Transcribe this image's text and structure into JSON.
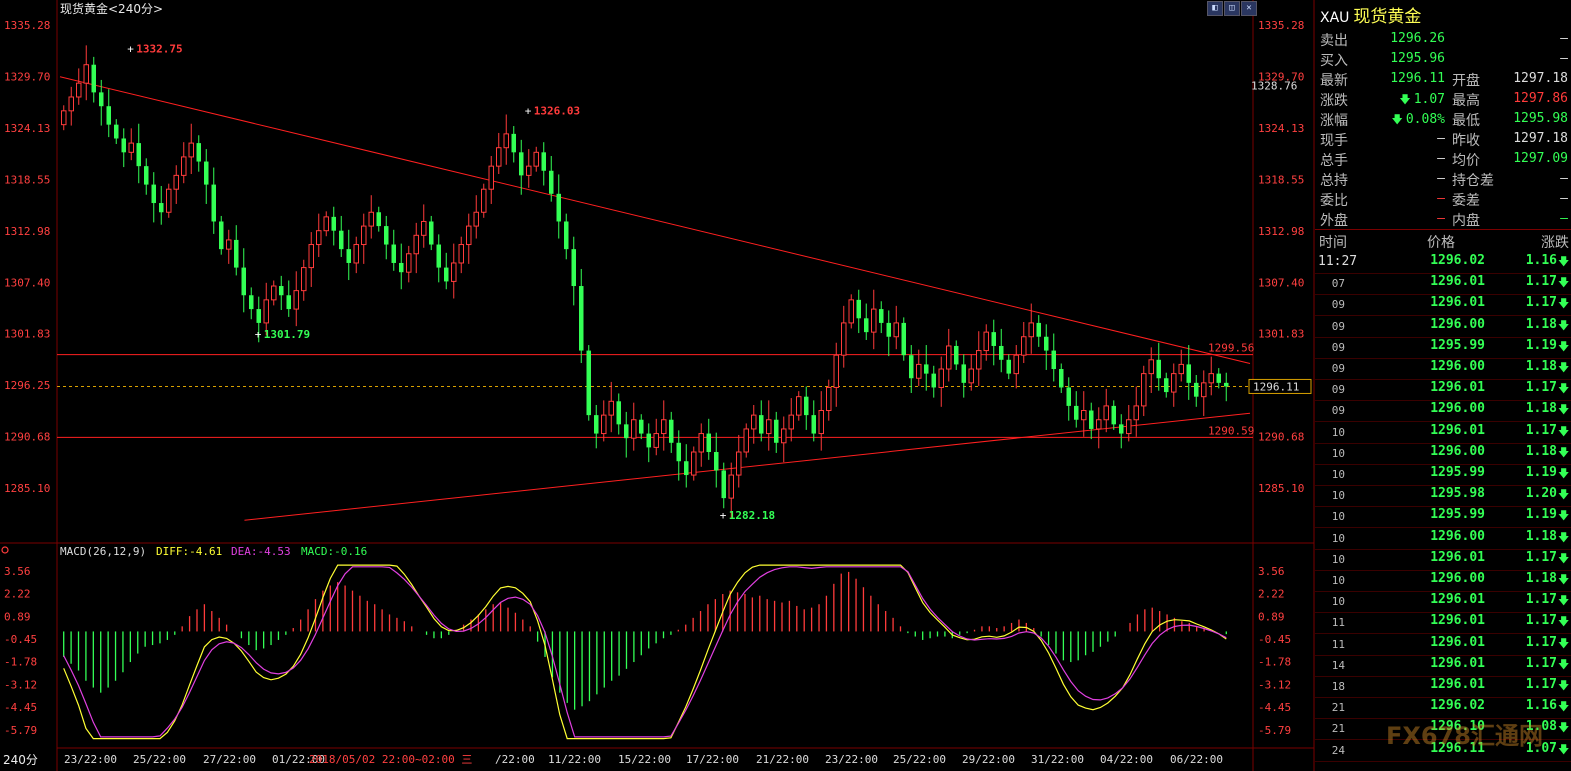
{
  "header": {
    "title": "现货黄金<240分>",
    "macd_label": "MACD(26,12,9)",
    "diff_label": "DIFF:-4.61",
    "dea_label": "DEA:-4.53",
    "macd_value_label": "MACD:-0.16",
    "period_label": "240分",
    "date_overlay": "2018/05/02 22:00~02:00 三"
  },
  "colors": {
    "up": "#ff3b3b",
    "down": "#33ff55",
    "diff": "#ffff33",
    "dea": "#e040e0",
    "trend": "#ff2020"
  },
  "chart_data": {
    "type": "candlestick",
    "price_axis_ticks": [
      "1335.28",
      "1329.70",
      "1324.13",
      "1318.55",
      "1312.98",
      "1307.40",
      "1301.83",
      "1296.25",
      "1290.68",
      "1285.10"
    ],
    "right_axis_extra": "1328.76",
    "ylim": [
      1280.0,
      1336.5
    ],
    "x_ticks": [
      "23/22:00",
      "25/22:00",
      "27/22:00",
      "01/22:00",
      "/22:00",
      "11/22:00",
      "15/22:00",
      "17/22:00",
      "21/22:00",
      "23/22:00",
      "25/22:00",
      "29/22:00",
      "31/22:00",
      "04/22:00",
      "06/22:00"
    ],
    "annotations": {
      "high1": "1332.75",
      "high2": "1326.03",
      "low1": "1301.79",
      "low2": "1282.18",
      "resistance": "1299.56",
      "support": "1290.59",
      "current": "1296.11"
    },
    "levels": {
      "resistance": 1299.56,
      "support": 1290.59,
      "current": 1296.11
    },
    "trendlines": [
      {
        "from": [
          0,
          1329.7
        ],
        "to": [
          1.0,
          1298.6
        ]
      },
      {
        "from": [
          0.155,
          1281.6
        ],
        "to": [
          1.0,
          1293.2
        ]
      }
    ],
    "macd_axis_ticks": [
      "3.56",
      "2.22",
      "0.89",
      "-0.45",
      "-1.78",
      "-3.12",
      "-4.45",
      "-5.79"
    ],
    "macd_ylim": [
      -6.5,
      4.2
    ],
    "diff_last": -4.61,
    "dea_last": -4.53,
    "macd_last": -0.16,
    "closes": [
      1326.0,
      1327.5,
      1329.0,
      1331.0,
      1328.0,
      1326.5,
      1324.5,
      1323.0,
      1321.5,
      1322.5,
      1320.0,
      1318.0,
      1316.0,
      1315.0,
      1317.5,
      1319.0,
      1321.0,
      1322.5,
      1320.5,
      1318.0,
      1314.0,
      1311.0,
      1312.0,
      1309.0,
      1306.0,
      1304.5,
      1303.0,
      1305.5,
      1307.0,
      1306.0,
      1304.5,
      1306.5,
      1309.0,
      1311.5,
      1313.0,
      1314.5,
      1313.0,
      1311.0,
      1309.5,
      1311.5,
      1313.5,
      1315.0,
      1313.5,
      1311.5,
      1309.5,
      1308.5,
      1310.5,
      1312.5,
      1314.0,
      1311.5,
      1309.0,
      1307.5,
      1309.5,
      1311.5,
      1313.5,
      1315.0,
      1317.5,
      1320.0,
      1322.0,
      1323.5,
      1321.5,
      1319.0,
      1320.0,
      1321.5,
      1319.5,
      1317.0,
      1314.0,
      1311.0,
      1307.0,
      1300.0,
      1293.0,
      1291.0,
      1293.0,
      1294.5,
      1292.0,
      1290.5,
      1292.5,
      1291.0,
      1289.5,
      1291.0,
      1292.5,
      1290.0,
      1288.0,
      1286.5,
      1289.0,
      1291.0,
      1289.0,
      1287.0,
      1284.0,
      1286.5,
      1289.0,
      1291.5,
      1293.0,
      1291.0,
      1292.5,
      1290.0,
      1291.5,
      1293.0,
      1295.0,
      1293.0,
      1291.0,
      1293.5,
      1296.0,
      1299.5,
      1303.0,
      1305.5,
      1303.5,
      1302.0,
      1304.5,
      1303.0,
      1301.5,
      1303.0,
      1299.5,
      1297.0,
      1298.5,
      1297.5,
      1296.0,
      1298.0,
      1300.5,
      1298.5,
      1296.5,
      1298.0,
      1300.0,
      1302.0,
      1300.5,
      1299.0,
      1297.5,
      1299.5,
      1301.5,
      1303.0,
      1301.5,
      1300.0,
      1298.0,
      1296.0,
      1294.0,
      1292.5,
      1293.5,
      1291.5,
      1292.5,
      1294.0,
      1292.0,
      1291.0,
      1292.5,
      1294.0,
      1297.5,
      1299.0,
      1297.0,
      1295.5,
      1297.5,
      1298.5,
      1296.5,
      1295.0,
      1296.5,
      1297.5,
      1296.5,
      1296.11
    ],
    "macd_hist": [
      -1.5,
      -1.9,
      -2.3,
      -2.9,
      -3.3,
      -3.6,
      -3.3,
      -2.9,
      -2.4,
      -1.8,
      -1.3,
      -0.9,
      -0.8,
      -0.7,
      -0.5,
      -0.2,
      0.3,
      0.9,
      1.3,
      1.6,
      1.2,
      0.8,
      0.4,
      0.0,
      -0.4,
      -0.8,
      -1.1,
      -1.0,
      -0.8,
      -0.5,
      -0.2,
      0.2,
      0.7,
      1.3,
      1.9,
      2.4,
      2.7,
      2.9,
      2.7,
      2.4,
      2.1,
      1.8,
      1.6,
      1.3,
      1.0,
      0.8,
      0.6,
      0.3,
      0.0,
      -0.2,
      -0.4,
      -0.4,
      -0.2,
      0.1,
      0.4,
      0.7,
      1.0,
      1.3,
      1.6,
      1.7,
      1.4,
      1.1,
      0.7,
      0.3,
      -0.6,
      -1.5,
      -2.7,
      -3.6,
      -4.2,
      -4.6,
      -4.4,
      -4.1,
      -3.7,
      -3.3,
      -2.9,
      -2.6,
      -2.2,
      -1.8,
      -1.4,
      -1.0,
      -0.7,
      -0.4,
      -0.2,
      0.1,
      0.4,
      0.8,
      1.2,
      1.6,
      1.9,
      2.2,
      2.4,
      2.3,
      2.2,
      2.0,
      2.1,
      1.9,
      1.8,
      1.7,
      1.8,
      1.5,
      1.3,
      1.4,
      1.6,
      2.1,
      2.8,
      3.4,
      3.5,
      3.1,
      2.6,
      2.1,
      1.6,
      1.2,
      0.8,
      0.3,
      -0.1,
      -0.3,
      -0.5,
      -0.4,
      -0.3,
      -0.3,
      -0.4,
      -0.2,
      -0.1,
      0.1,
      0.3,
      0.3,
      0.2,
      0.3,
      0.5,
      0.7,
      0.5,
      0.2,
      -0.3,
      -0.8,
      -1.3,
      -1.7,
      -1.8,
      -1.7,
      -1.4,
      -1.2,
      -0.9,
      -0.6,
      -0.3,
      0.0,
      0.5,
      1.0,
      1.3,
      1.4,
      1.2,
      1.0,
      0.8,
      0.6,
      0.5,
      0.3,
      0.2,
      0.1,
      0.0,
      -0.16
    ]
  },
  "quote": {
    "title_code": "XAU",
    "title_name": "现货黄金",
    "rows_left": [
      {
        "label": "卖出",
        "value": "1296.26",
        "cls": "dn"
      },
      {
        "label": "买入",
        "value": "1295.96",
        "cls": "dn"
      },
      {
        "label": "最新",
        "value": "1296.11",
        "cls": "dn"
      },
      {
        "label": "涨跌",
        "value": "1.07",
        "cls": "dn",
        "arrow": "down-arrow-icon"
      },
      {
        "label": "涨幅",
        "value": "0.08%",
        "cls": "dn",
        "arrow": "down-arrow-icon"
      },
      {
        "label": "现手",
        "value": "—",
        "cls": "wh"
      },
      {
        "label": "总手",
        "value": "—",
        "cls": "wh"
      },
      {
        "label": "总持",
        "value": "—",
        "cls": "wh"
      },
      {
        "label": "委比",
        "value": "—",
        "cls": "up"
      },
      {
        "label": "外盘",
        "value": "—",
        "cls": "up"
      }
    ],
    "rows_right": [
      {
        "label": "",
        "value": "—",
        "cls": "wh"
      },
      {
        "label": "",
        "value": "—",
        "cls": "wh"
      },
      {
        "label": "开盘",
        "value": "1297.18",
        "cls": "wh"
      },
      {
        "label": "最高",
        "value": "1297.86",
        "cls": "up"
      },
      {
        "label": "最低",
        "value": "1295.98",
        "cls": "dn"
      },
      {
        "label": "昨收",
        "value": "1297.18",
        "cls": "wh"
      },
      {
        "label": "均价",
        "value": "1297.09",
        "cls": "dn"
      },
      {
        "label": "持仓差",
        "value": "—",
        "cls": "wh"
      },
      {
        "label": "委差",
        "value": "—",
        "cls": "wh"
      },
      {
        "label": "内盘",
        "value": "—",
        "cls": "dn"
      }
    ],
    "ticks_header": {
      "time": "时间",
      "price": "价格",
      "change": "涨跌"
    },
    "ticks": [
      {
        "time": "11:27",
        "price": "1296.02",
        "change": "1.16"
      },
      {
        "time": "07",
        "price": "1296.01",
        "change": "1.17"
      },
      {
        "time": "09",
        "price": "1296.01",
        "change": "1.17"
      },
      {
        "time": "09",
        "price": "1296.00",
        "change": "1.18"
      },
      {
        "time": "09",
        "price": "1295.99",
        "change": "1.19"
      },
      {
        "time": "09",
        "price": "1296.00",
        "change": "1.18"
      },
      {
        "time": "09",
        "price": "1296.01",
        "change": "1.17"
      },
      {
        "time": "09",
        "price": "1296.00",
        "change": "1.18"
      },
      {
        "time": "10",
        "price": "1296.01",
        "change": "1.17"
      },
      {
        "time": "10",
        "price": "1296.00",
        "change": "1.18"
      },
      {
        "time": "10",
        "price": "1295.99",
        "change": "1.19"
      },
      {
        "time": "10",
        "price": "1295.98",
        "change": "1.20"
      },
      {
        "time": "10",
        "price": "1295.99",
        "change": "1.19"
      },
      {
        "time": "10",
        "price": "1296.00",
        "change": "1.18"
      },
      {
        "time": "10",
        "price": "1296.01",
        "change": "1.17"
      },
      {
        "time": "10",
        "price": "1296.00",
        "change": "1.18"
      },
      {
        "time": "10",
        "price": "1296.01",
        "change": "1.17"
      },
      {
        "time": "11",
        "price": "1296.01",
        "change": "1.17"
      },
      {
        "time": "11",
        "price": "1296.01",
        "change": "1.17"
      },
      {
        "time": "14",
        "price": "1296.01",
        "change": "1.17"
      },
      {
        "time": "18",
        "price": "1296.01",
        "change": "1.17"
      },
      {
        "time": "21",
        "price": "1296.02",
        "change": "1.16"
      },
      {
        "time": "21",
        "price": "1296.10",
        "change": "1.08"
      },
      {
        "time": "24",
        "price": "1296.11",
        "change": "1.07"
      }
    ]
  },
  "watermark": "FX678汇通网"
}
